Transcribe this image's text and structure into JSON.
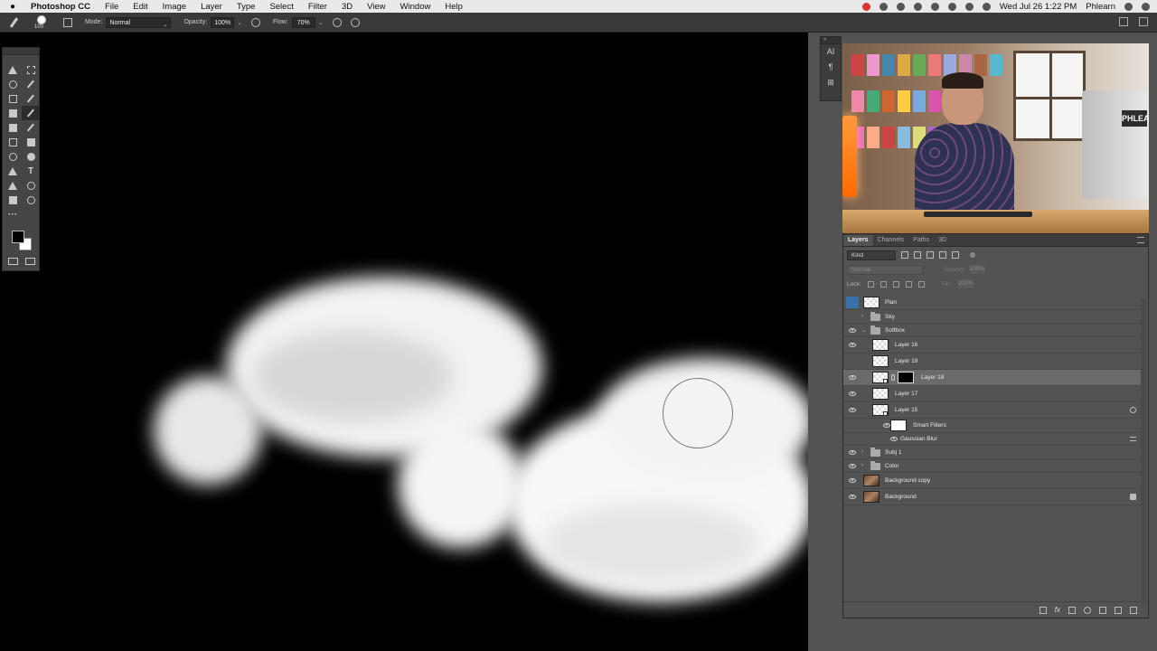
{
  "menubar": {
    "app_name": "Photoshop CC",
    "items": [
      "File",
      "Edit",
      "Image",
      "Layer",
      "Type",
      "Select",
      "Filter",
      "3D",
      "View",
      "Window",
      "Help"
    ],
    "clock": "Wed Jul 26  1:22 PM",
    "user": "Phlearn"
  },
  "options": {
    "brush_size": "100",
    "mode_label": "Mode:",
    "mode_value": "Normal",
    "opacity_label": "Opacity:",
    "opacity_value": "100%",
    "flow_label": "Flow:",
    "flow_value": "70%"
  },
  "mini_panel": {
    "items": [
      "AI",
      "¶",
      "⊞"
    ]
  },
  "video": {
    "monitor_logo": "PHLEA"
  },
  "layers": {
    "tabs": [
      "Layers",
      "Channels",
      "Paths",
      "3D"
    ],
    "kind": "Kind",
    "blend_mode": "Normal",
    "opacity_label": "Opacity:",
    "opacity_value": "100%",
    "lock_label": "Lock:",
    "fill_label": "Fill:",
    "fill_value": "100%",
    "list": [
      {
        "name": "Plan"
      },
      {
        "name": "Sky"
      },
      {
        "name": "Softbox"
      },
      {
        "name": "Layer 16"
      },
      {
        "name": "Layer 19"
      },
      {
        "name": "Layer 18"
      },
      {
        "name": "Layer 17"
      },
      {
        "name": "Layer 15"
      },
      {
        "name": "Smart Filters"
      },
      {
        "name": "Gaussian Blur"
      },
      {
        "name": "Subj 1"
      },
      {
        "name": "Color"
      },
      {
        "name": "Background copy"
      },
      {
        "name": "Background"
      }
    ]
  },
  "colors": {
    "foreground": "#000000",
    "background": "#ffffff",
    "selected_layer": "#6a6a6a"
  }
}
